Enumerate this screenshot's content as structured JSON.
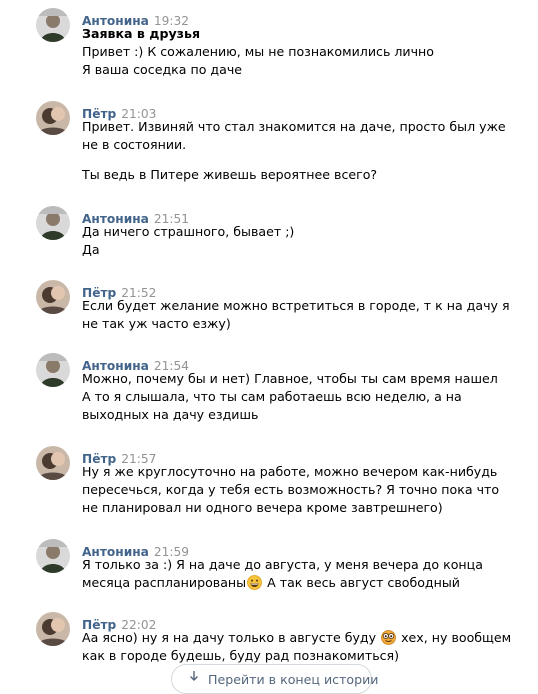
{
  "colors": {
    "author": "#42648b",
    "time": "#939393",
    "text": "#000000",
    "button_text": "#55677d"
  },
  "messages": [
    {
      "author": "Антонина",
      "time": "19:32",
      "avatar": "antonina",
      "lines": [
        "Заявка в друзья",
        "Привет :) К сожалению, мы не познакомились лично",
        "Я ваша соседка по даче"
      ]
    },
    {
      "author": "Пётр",
      "time": "21:03",
      "avatar": "petr",
      "lines": [
        "Привет. Извиняй что стал знакомится на даче, просто был уже",
        "не в состоянии.",
        "",
        "Ты ведь в Питере живешь вероятнее всего?"
      ]
    },
    {
      "author": "Антонина",
      "time": "21:51",
      "avatar": "antonina",
      "lines": [
        "Да ничего страшного, бывает ;)",
        "Да"
      ]
    },
    {
      "author": "Пётр",
      "time": "21:52",
      "avatar": "petr",
      "lines": [
        "Если будет желание можно встретиться в городе, т к на дачу я",
        "не так уж часто езжу)"
      ]
    },
    {
      "author": "Антонина",
      "time": "21:54",
      "avatar": "antonina",
      "lines": [
        "Можно, почему бы и нет) Главное, чтобы ты сам время нашел",
        "А то я слышала, что ты сам работаешь всю неделю, а на",
        "выходных на дачу ездишь"
      ]
    },
    {
      "author": "Пётр",
      "time": "21:57",
      "avatar": "petr",
      "lines": [
        "Ну я же круглосуточно на работе, можно вечером как-нибудь",
        "пересечься, когда у тебя есть возможность? Я точно пока что",
        "не планировал ни одного вечера кроме завтрешнего)"
      ]
    },
    {
      "author": "Антонина",
      "time": "21:59",
      "avatar": "antonina",
      "lines": [
        "Я только за :) Я на даче до августа, у меня вечера до конца",
        "месяца распланированы",
        " А так весь август свободный"
      ],
      "emojis": [
        "grinning-face-emoji"
      ]
    },
    {
      "author": "Пётр",
      "time": "22:02",
      "avatar": "petr",
      "lines": [
        "Аа ясно) ну я на дачу только в августе буду ",
        " хех, ну вообщем",
        "как в городе будешь, буду рад познакомиться)"
      ],
      "emojis": [
        "goggle-eyes-emoji"
      ]
    }
  ],
  "history_button": {
    "label": "Перейти в конец истории",
    "icon": "arrow-down-icon"
  }
}
